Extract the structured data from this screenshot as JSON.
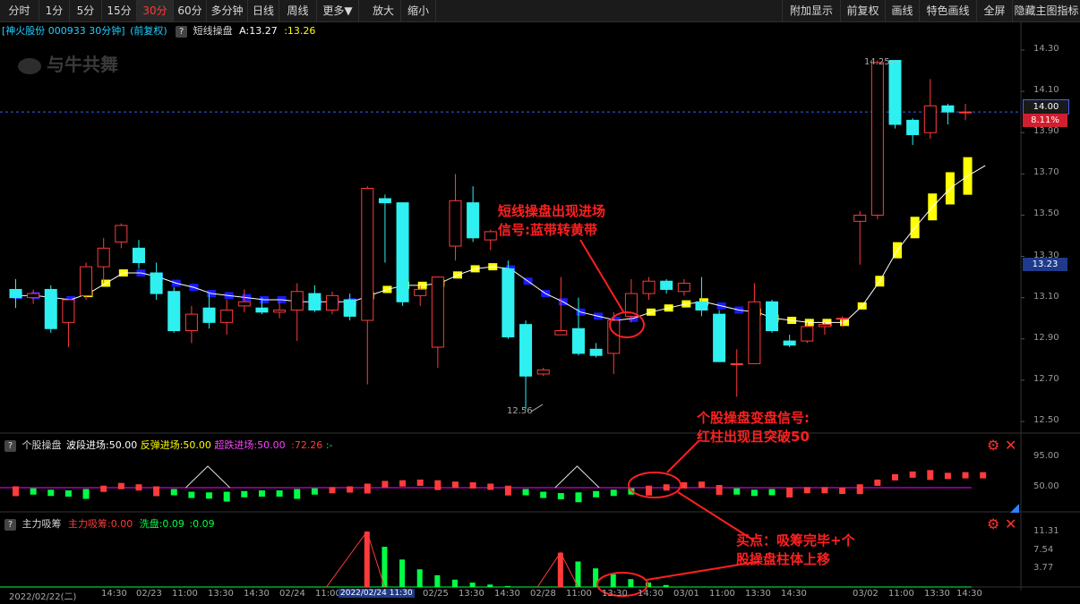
{
  "toolbar": {
    "left": [
      "分时",
      "1分",
      "5分",
      "15分",
      "30分",
      "60分",
      "多分钟",
      "日线",
      "周线",
      "更多▼",
      "放大",
      "缩小"
    ],
    "active": "30分",
    "right": [
      "附加显示",
      "前复权",
      "画线",
      "特色画线",
      "全屏",
      "隐藏主图指标"
    ]
  },
  "stock": {
    "name_code": "[神火股份 000933 30分钟]",
    "adjust": "(前复权)",
    "indicator": "短线操盘",
    "a_label": "A:13.27",
    "b_value": ":13.26",
    "help": "?"
  },
  "watermark": "与牛共舞",
  "price_axis": [
    "14.30",
    "14.10",
    "13.90",
    "13.70",
    "13.50",
    "13.30",
    "13.10",
    "12.90",
    "12.70",
    "12.50"
  ],
  "price_tags": {
    "current": "14.00",
    "percent": "8.11%",
    "cursor": "13.23"
  },
  "markers": {
    "high": "14.25",
    "low": "12.56"
  },
  "panel2": {
    "title": "个股操盘",
    "l1": "波段进场:50.00",
    "l2": "反弹进场:50.00",
    "l3": "超跌进场:50.00",
    "l4": ":72.26",
    "l5": ":-",
    "axis": [
      "95.00",
      "50.00"
    ]
  },
  "panel3": {
    "title": "主力吸筹",
    "l1": "主力吸筹:0.00",
    "l2": "洗盘:0.09",
    "l3": ":0.09",
    "axis": [
      "11.31",
      "7.54",
      "3.77"
    ]
  },
  "time_axis": [
    "2022/02/22(二)",
    "14:30",
    "02/23",
    "11:00",
    "13:30",
    "14:30",
    "02/24",
    "11:00",
    "2022/02/24 11:30",
    "02/25",
    "13:30",
    "14:30",
    "02/28",
    "11:00",
    "13:30",
    "14:30",
    "03/01",
    "11:00",
    "13:30",
    "14:30",
    "03/02",
    "11:00",
    "13:30",
    "14:30"
  ],
  "annotations": {
    "a1": [
      "短线操盘出现进场",
      "信号:蓝带转黄带"
    ],
    "a2": [
      "个股操盘变盘信号:",
      "红柱出现且突破50"
    ],
    "a3": [
      "买点：吸筹完毕+个",
      "股操盘柱体上移"
    ]
  },
  "colors": {
    "up": "#ff3b3b",
    "down": "#2ff0f0",
    "yellow": "#ffff00",
    "blue": "#1a1aff",
    "magenta": "#ff00ff",
    "green": "#00ff44"
  },
  "chart_data": {
    "type": "candlestick",
    "candles": [
      {
        "o": 13.14,
        "h": 13.19,
        "l": 13.05,
        "c": 13.1
      },
      {
        "o": 13.1,
        "h": 13.14,
        "l": 13.07,
        "c": 13.12
      },
      {
        "o": 13.14,
        "h": 13.16,
        "l": 12.93,
        "c": 12.95
      },
      {
        "o": 12.98,
        "h": 13.04,
        "l": 12.86,
        "c": 13.09
      },
      {
        "o": 13.11,
        "h": 13.27,
        "l": 13.09,
        "c": 13.25
      },
      {
        "o": 13.25,
        "h": 13.39,
        "l": 13.17,
        "c": 13.34
      },
      {
        "o": 13.37,
        "h": 13.46,
        "l": 13.34,
        "c": 13.45
      },
      {
        "o": 13.34,
        "h": 13.38,
        "l": 13.24,
        "c": 13.27
      },
      {
        "o": 13.22,
        "h": 13.27,
        "l": 13.09,
        "c": 13.12
      },
      {
        "o": 13.13,
        "h": 13.15,
        "l": 12.93,
        "c": 12.94
      },
      {
        "o": 12.94,
        "h": 13.06,
        "l": 12.88,
        "c": 13.02
      },
      {
        "o": 13.05,
        "h": 13.12,
        "l": 12.95,
        "c": 12.98
      },
      {
        "o": 12.98,
        "h": 13.09,
        "l": 12.92,
        "c": 13.04
      },
      {
        "o": 13.06,
        "h": 13.14,
        "l": 13.03,
        "c": 13.08
      },
      {
        "o": 13.05,
        "h": 13.1,
        "l": 13.02,
        "c": 13.03
      },
      {
        "o": 13.03,
        "h": 13.08,
        "l": 13.0,
        "c": 13.04
      },
      {
        "o": 13.04,
        "h": 13.17,
        "l": 12.89,
        "c": 13.13
      },
      {
        "o": 13.12,
        "h": 13.16,
        "l": 13.03,
        "c": 13.04
      },
      {
        "o": 13.04,
        "h": 13.13,
        "l": 13.02,
        "c": 13.11
      },
      {
        "o": 13.09,
        "h": 13.12,
        "l": 12.99,
        "c": 13.01
      },
      {
        "o": 12.99,
        "h": 13.64,
        "l": 12.68,
        "c": 13.63
      },
      {
        "o": 13.58,
        "h": 13.6,
        "l": 13.27,
        "c": 13.56
      },
      {
        "o": 13.56,
        "h": 13.56,
        "l": 13.06,
        "c": 13.08
      },
      {
        "o": 13.11,
        "h": 13.16,
        "l": 13.06,
        "c": 13.14
      },
      {
        "o": 12.86,
        "h": 13.2,
        "l": 12.76,
        "c": 13.2
      },
      {
        "o": 13.35,
        "h": 13.7,
        "l": 13.28,
        "c": 13.57
      },
      {
        "o": 13.56,
        "h": 13.64,
        "l": 13.37,
        "c": 13.39
      },
      {
        "o": 13.38,
        "h": 13.43,
        "l": 13.33,
        "c": 13.42
      },
      {
        "o": 13.24,
        "h": 13.28,
        "l": 12.9,
        "c": 12.91
      },
      {
        "o": 12.97,
        "h": 12.99,
        "l": 12.56,
        "c": 12.72
      },
      {
        "o": 12.73,
        "h": 12.76,
        "l": 12.72,
        "c": 12.75
      },
      {
        "o": 12.92,
        "h": 13.2,
        "l": 12.92,
        "c": 12.94
      },
      {
        "o": 12.95,
        "h": 13.1,
        "l": 12.82,
        "c": 12.83
      },
      {
        "o": 12.85,
        "h": 12.88,
        "l": 12.81,
        "c": 12.82
      },
      {
        "o": 12.83,
        "h": 13.03,
        "l": 12.73,
        "c": 12.99
      },
      {
        "o": 13.01,
        "h": 13.19,
        "l": 12.98,
        "c": 13.12
      },
      {
        "o": 13.12,
        "h": 13.2,
        "l": 13.09,
        "c": 13.18
      },
      {
        "o": 13.18,
        "h": 13.19,
        "l": 13.12,
        "c": 13.14
      },
      {
        "o": 13.13,
        "h": 13.19,
        "l": 13.11,
        "c": 13.17
      },
      {
        "o": 13.08,
        "h": 13.2,
        "l": 13.01,
        "c": 13.04
      },
      {
        "o": 13.02,
        "h": 13.04,
        "l": 12.79,
        "c": 12.79
      },
      {
        "o": 12.78,
        "h": 12.85,
        "l": 12.62,
        "c": 12.78
      },
      {
        "o": 12.78,
        "h": 13.17,
        "l": 12.78,
        "c": 13.08
      },
      {
        "o": 13.08,
        "h": 13.09,
        "l": 12.93,
        "c": 12.94
      },
      {
        "o": 12.89,
        "h": 12.92,
        "l": 12.86,
        "c": 12.87
      },
      {
        "o": 12.89,
        "h": 12.98,
        "l": 12.88,
        "c": 12.96
      },
      {
        "o": 12.96,
        "h": 12.98,
        "l": 12.92,
        "c": 12.97
      },
      {
        "o": 13.0,
        "h": 13.01,
        "l": 12.96,
        "c": 13.0
      },
      {
        "o": 13.47,
        "h": 13.52,
        "l": 13.26,
        "c": 13.5
      },
      {
        "o": 13.5,
        "h": 14.25,
        "l": 13.48,
        "c": 14.24
      },
      {
        "o": 14.25,
        "h": 14.25,
        "l": 13.92,
        "c": 13.94
      },
      {
        "o": 13.96,
        "h": 13.97,
        "l": 13.84,
        "c": 13.89
      },
      {
        "o": 13.9,
        "h": 14.16,
        "l": 13.87,
        "c": 14.03
      },
      {
        "o": 14.03,
        "h": 14.04,
        "l": 13.94,
        "c": 14.0
      },
      {
        "o": 14.0,
        "h": 14.04,
        "l": 13.96,
        "c": 14.0
      }
    ],
    "band": [
      13.11,
      13.11,
      13.1,
      13.09,
      13.12,
      13.17,
      13.22,
      13.22,
      13.2,
      13.17,
      13.15,
      13.12,
      13.11,
      13.1,
      13.09,
      13.09,
      13.08,
      13.08,
      13.08,
      13.08,
      13.11,
      13.14,
      13.16,
      13.16,
      13.17,
      13.21,
      13.24,
      13.25,
      13.24,
      13.18,
      13.12,
      13.08,
      13.03,
      13.01,
      12.99,
      13.0,
      13.03,
      13.05,
      13.07,
      13.08,
      13.06,
      13.04,
      13.03,
      13.0,
      12.99,
      12.98,
      12.98,
      12.98,
      13.06,
      13.18,
      13.33,
      13.44,
      13.54,
      13.63,
      13.69,
      13.74,
      13.77
    ],
    "band_color": [
      "b",
      "b",
      "b",
      "b",
      "y",
      "y",
      "y",
      "b",
      "b",
      "b",
      "b",
      "b",
      "b",
      "b",
      "b",
      "b",
      "b",
      "b",
      "b",
      "b",
      "y",
      "y",
      "y",
      "y",
      "y",
      "y",
      "y",
      "y",
      "b",
      "b",
      "b",
      "b",
      "b",
      "b",
      "b",
      "b",
      "y",
      "y",
      "y",
      "y",
      "b",
      "b",
      "y",
      "y",
      "y",
      "y",
      "y",
      "y",
      "y",
      "y",
      "y",
      "y",
      "y",
      "y",
      "y",
      "y",
      "y"
    ],
    "op_bars": [
      52,
      49,
      47,
      46,
      48,
      53,
      57,
      55,
      52,
      48,
      44,
      43,
      44,
      45,
      46,
      46,
      48,
      49,
      51,
      52,
      56,
      60,
      61,
      62,
      61,
      59,
      58,
      56,
      53,
      48,
      44,
      42,
      43,
      45,
      47,
      49,
      53,
      55,
      58,
      59,
      54,
      49,
      47,
      48,
      50,
      51,
      51,
      50,
      55,
      62,
      70,
      74,
      76,
      72,
      73,
      73
    ],
    "op_lines": [
      {
        "name": "波段进场",
        "color": "#ff00ff",
        "value": 50
      }
    ],
    "absorb": [
      0,
      0,
      0,
      0,
      0,
      0,
      0,
      0,
      0,
      0,
      0,
      0,
      0,
      0,
      0,
      0,
      0,
      0,
      0,
      0,
      11.3,
      8.2,
      5.6,
      3.6,
      2.4,
      1.5,
      0.9,
      0.5,
      0.2,
      0,
      0,
      7.0,
      5.2,
      3.8,
      2.6,
      1.6,
      0.9,
      0.4,
      0.1,
      0,
      0,
      0,
      0,
      0,
      0,
      0,
      0,
      0,
      0,
      0,
      0,
      0,
      0,
      0,
      0,
      0
    ]
  }
}
